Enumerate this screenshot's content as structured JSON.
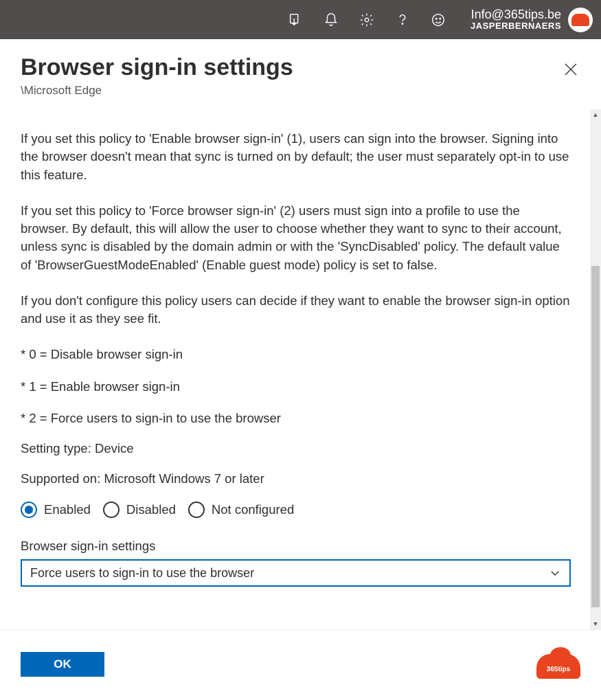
{
  "topbar": {
    "user_email": "Info@365tips.be",
    "user_name": "JASPERBERNAERS"
  },
  "header": {
    "title": "Browser sign-in settings",
    "breadcrumb": "\\Microsoft Edge"
  },
  "description": {
    "p1": "If you set this policy to 'Enable browser sign-in' (1), users can sign into the browser. Signing into the browser doesn't mean that sync is turned on by default; the user must separately opt-in to use this feature.",
    "p2": "If you set this policy to 'Force browser sign-in' (2) users must sign into a profile to use the browser. By default, this will allow the user to choose whether they want to sync to their account, unless sync is disabled by the domain admin or with the 'SyncDisabled' policy. The default value of 'BrowserGuestModeEnabled' (Enable guest mode) policy is set to false.",
    "p3": "If you don't configure this policy users can decide if they want to enable the browser sign-in option and use it as they see fit.",
    "opt0": "* 0 = Disable browser sign-in",
    "opt1": "* 1 = Enable browser sign-in",
    "opt2": "* 2 = Force users to sign-in to use the browser",
    "setting_type": "Setting type: Device",
    "supported_on": "Supported on: Microsoft Windows 7 or later"
  },
  "radios": {
    "enabled": "Enabled",
    "disabled": "Disabled",
    "not_configured": "Not configured"
  },
  "select_field": {
    "label": "Browser sign-in settings",
    "value": "Force users to sign-in to use the browser"
  },
  "footer": {
    "ok": "OK",
    "brand": "365tips"
  }
}
